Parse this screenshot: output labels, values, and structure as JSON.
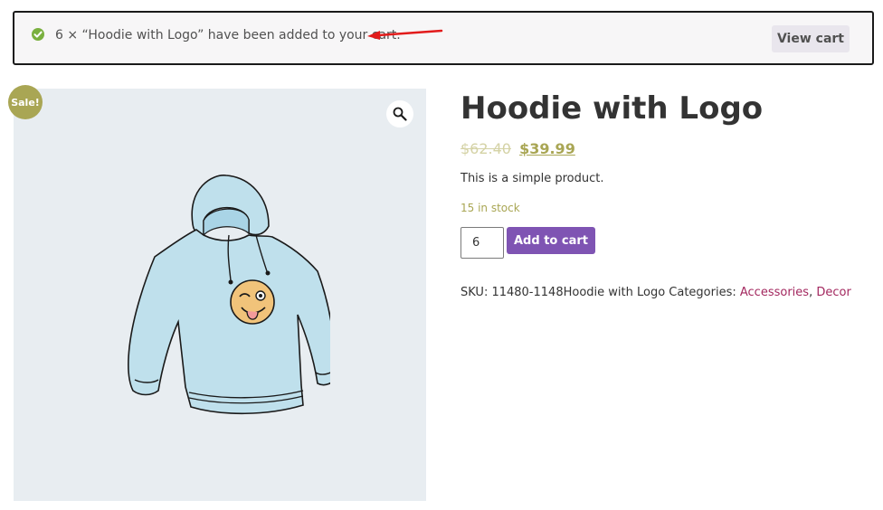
{
  "notice": {
    "message": "6 × “Hoodie with Logo” have been added to your cart.",
    "view_cart_label": "View cart",
    "check_color": "#7ab03f",
    "arrow_color": "#e21b1b"
  },
  "product": {
    "sale_badge": "Sale!",
    "title": "Hoodie with Logo",
    "regular_price": "$62.40",
    "sale_price": "$39.99",
    "short_description": "This is a simple product.",
    "stock": "15 in stock",
    "quantity": "6",
    "add_to_cart_label": "Add to cart",
    "meta_prefix": "SKU: 11480-1148Hoodie with Logo Categories: ",
    "categories": [
      "Accessories",
      "Decor"
    ],
    "category_separator": ", "
  },
  "colors": {
    "accent": "#a9a654",
    "button_purple": "#7f54b3",
    "link": "#a3285f"
  },
  "icons": {
    "notice": "check-circle-icon",
    "gallery": "magnifier-icon"
  }
}
